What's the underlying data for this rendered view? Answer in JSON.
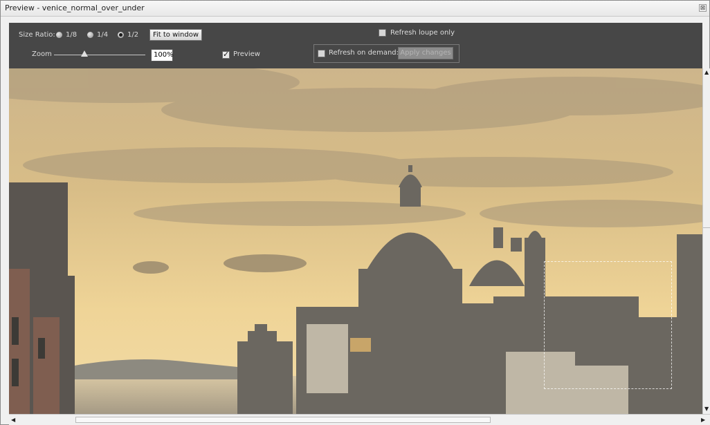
{
  "window": {
    "title": "Preview - venice_normal_over_under",
    "close_glyph": "⊠"
  },
  "toolbar": {
    "size_ratio_label": "Size Ratio:",
    "ratios": [
      {
        "label": "1/8",
        "selected": false
      },
      {
        "label": "1/4",
        "selected": false
      },
      {
        "label": "1/2",
        "selected": true
      }
    ],
    "fit_to_window_label": "Fit to window",
    "zoom_label": "Zoom",
    "zoom_value": "100%",
    "zoom_level": 0.35,
    "preview_label": "Preview",
    "preview_checked": true,
    "refresh_loupe_label": "Refresh loupe only",
    "refresh_loupe_checked": false,
    "refresh_on_demand_label": "Refresh on demand:",
    "refresh_on_demand_checked": false,
    "apply_changes_label": "Apply changes"
  },
  "viewport": {
    "description_icon": "image-preview",
    "sky_color": "#e8c98a",
    "building_color": "#6f6a62"
  },
  "scrollbars": {
    "up_arrow": "▲",
    "down_arrow": "▼",
    "left_arrow": "◀",
    "right_arrow": "▶"
  }
}
